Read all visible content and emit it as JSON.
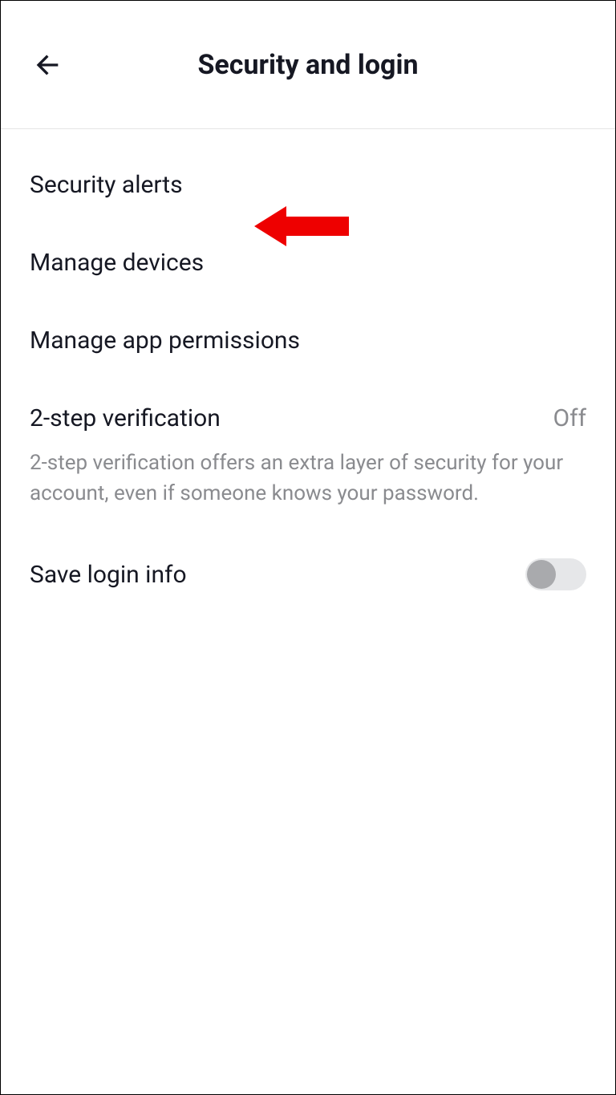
{
  "header": {
    "title": "Security and login"
  },
  "items": {
    "security_alerts": {
      "label": "Security alerts"
    },
    "manage_devices": {
      "label": "Manage devices"
    },
    "manage_permissions": {
      "label": "Manage app permissions"
    },
    "two_step": {
      "label": "2-step verification",
      "value": "Off",
      "description": "2-step verification offers an extra layer of security for your account, even if someone knows your password."
    },
    "save_login": {
      "label": "Save login info",
      "toggled": false
    }
  }
}
